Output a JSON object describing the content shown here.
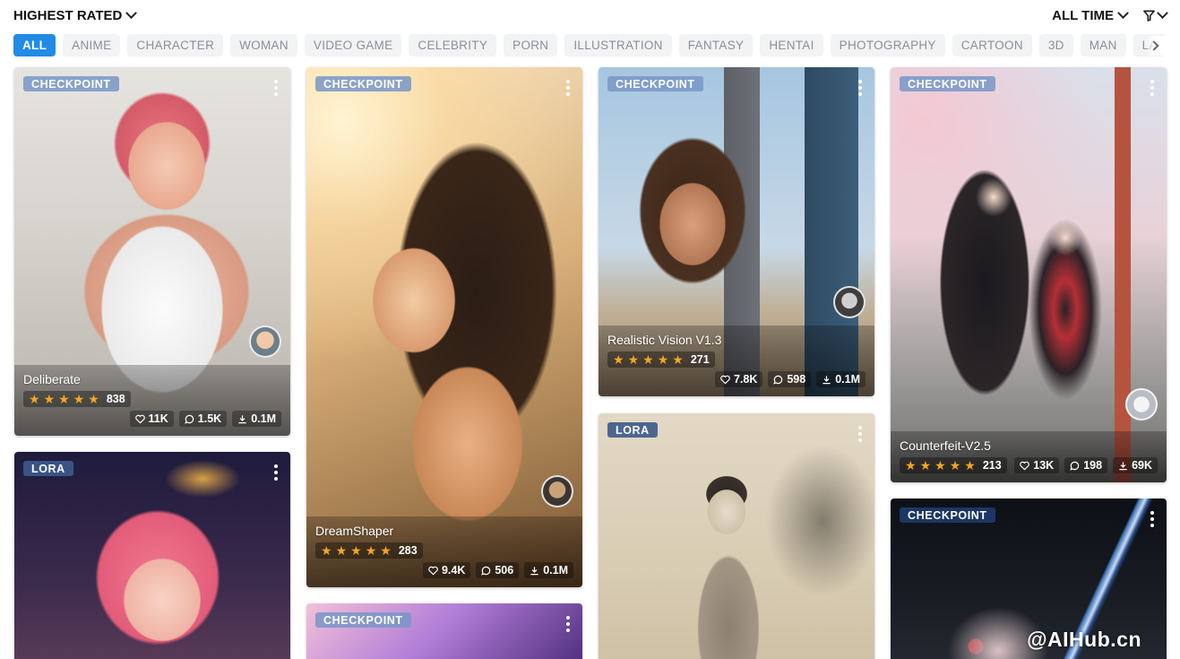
{
  "header": {
    "sort_label": "HIGHEST RATED",
    "period_label": "ALL TIME"
  },
  "chips": [
    "ALL",
    "ANIME",
    "CHARACTER",
    "WOMAN",
    "VIDEO GAME",
    "CELEBRITY",
    "PORN",
    "ILLUSTRATION",
    "FANTASY",
    "HENTAI",
    "PHOTOGRAPHY",
    "CARTOON",
    "3D",
    "MAN",
    "LANDSCAPE"
  ],
  "cards": {
    "deliberate": {
      "badge": "CHECKPOINT",
      "title": "Deliberate",
      "rating": "838",
      "likes": "11K",
      "comments": "1.5K",
      "downloads": "0.1M"
    },
    "dreamshaper": {
      "badge": "CHECKPOINT",
      "title": "DreamShaper",
      "rating": "283",
      "likes": "9.4K",
      "comments": "506",
      "downloads": "0.1M"
    },
    "realistic": {
      "badge": "CHECKPOINT",
      "title": "Realistic Vision V1.3",
      "rating": "271",
      "likes": "7.8K",
      "comments": "598",
      "downloads": "0.1M"
    },
    "counterfeit": {
      "badge": "CHECKPOINT",
      "title": "Counterfeit-V2.5",
      "rating": "213",
      "likes": "13K",
      "comments": "198",
      "downloads": "69K"
    },
    "lora1": {
      "badge": "LORA"
    },
    "lora2": {
      "badge": "LORA"
    },
    "cp5": {
      "badge": "CHECKPOINT"
    },
    "cp6": {
      "badge": "CHECKPOINT"
    }
  },
  "watermark": "@AIHub.cn",
  "icons": {
    "sort": "chevron-down-icon",
    "filter": "filter-icon",
    "more": "kebab-icon",
    "like": "heart-icon",
    "comment": "comment-icon",
    "download": "download-icon",
    "star": "star-icon"
  }
}
